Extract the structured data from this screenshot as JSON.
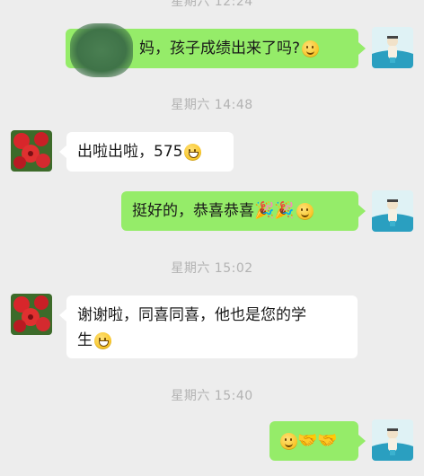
{
  "timestamps": {
    "t0": "星期六 12:24",
    "t1": "星期六 14:48",
    "t2": "星期六 15:02",
    "t3": "星期六 15:40"
  },
  "messages": [
    {
      "side": "sent",
      "text": "妈，孩子成绩出来了吗?",
      "emoji": [
        "smile"
      ]
    },
    {
      "side": "received",
      "text": "出啦出啦，575",
      "emoji": [
        "grin"
      ]
    },
    {
      "side": "sent",
      "text": "挺好的，恭喜恭喜",
      "emoji": [
        "party-popper",
        "party-popper",
        "smile"
      ]
    },
    {
      "side": "received",
      "text_line1": "谢谢啦，同喜同喜，他也是您的学",
      "text_line2": "生",
      "emoji": [
        "grin"
      ]
    },
    {
      "side": "sent",
      "text": "",
      "emoji": [
        "smile",
        "handshake",
        "handshake"
      ]
    }
  ],
  "colors": {
    "background": "#ededed",
    "sent_bubble": "#95ec69",
    "received_bubble": "#ffffff",
    "timestamp": "#b2b2b2"
  }
}
